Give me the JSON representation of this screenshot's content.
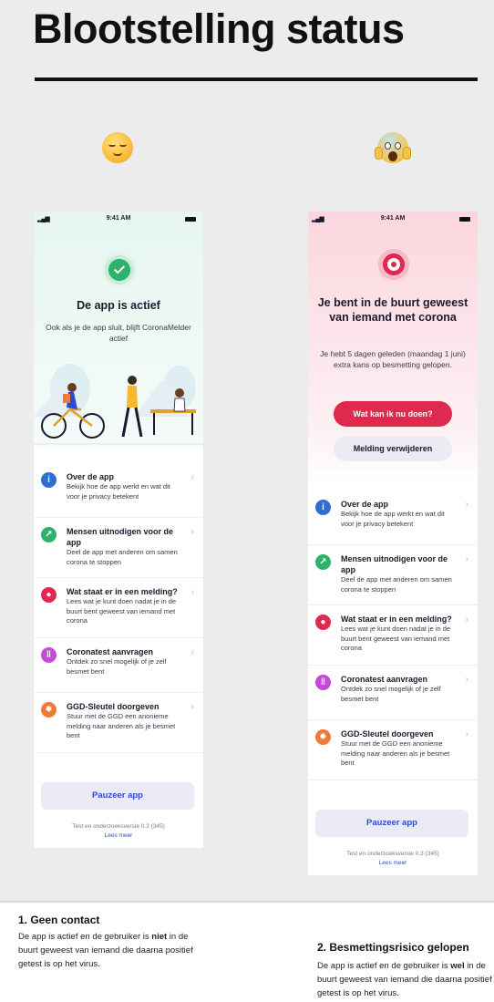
{
  "page": {
    "title": "Blootstelling status"
  },
  "left_phone": {
    "status": {
      "time": "9:41 AM"
    },
    "hero": {
      "title": "De app is actief",
      "text": "Ook als je de app sluit, blijft CoronaMelder actief"
    },
    "menu": [
      {
        "label": "Over de app",
        "desc": "Bekijk hoe de app werkt en wat dit voor je privacy betekent",
        "icon": "info-icon",
        "color": "#2c6fd1"
      },
      {
        "label": "Mensen uitnodigen voor de app",
        "desc": "Deel de app met anderen om samen corona te stoppen",
        "icon": "share-icon",
        "color": "#2eb26b"
      },
      {
        "label": "Wat staat er in een melding?",
        "desc": "Lees wat je kunt doen nadat je in de buurt bent geweest van iemand met corona",
        "icon": "notification-icon",
        "color": "#e0294e"
      },
      {
        "label": "Coronatest aanvragen",
        "desc": "Ontdek zo snel mogelijk of je zelf besmet bent",
        "icon": "test-tube-icon",
        "color": "#c44bd6"
      },
      {
        "label": "GGD-Sleutel doorgeven",
        "desc": "Stuur met de GGD een anonieme melding naar anderen als je besmet bent",
        "icon": "virus-icon",
        "color": "#f07a3a"
      }
    ],
    "pause_button": "Pauzeer app",
    "version": "Test en onderzoeksversie 0.3 (345)",
    "more_link": "Lees meer"
  },
  "right_phone": {
    "status": {
      "time": "9:41 AM"
    },
    "hero": {
      "title": "Je bent in de buurt geweest van iemand met corona",
      "text": "Je hebt 5 dagen geleden (maandag 1 juni) extra kans op besmetting gelopen."
    },
    "primary_button": "Wat kan ik nu doen?",
    "secondary_button": "Melding verwijderen",
    "menu": [
      {
        "label": "Over de app",
        "desc": "Bekijk hoe de app werkt en wat dit voor je privacy betekent",
        "icon": "info-icon",
        "color": "#2c6fd1"
      },
      {
        "label": "Mensen uitnodigen voor de app",
        "desc": "Deel de app met anderen om samen corona te stoppen",
        "icon": "share-icon",
        "color": "#2eb26b"
      },
      {
        "label": "Wat staat er in een melding?",
        "desc": "Lees wat je kunt doen nadat je in de buurt bent geweest van iemand met corona",
        "icon": "notification-icon",
        "color": "#e0294e"
      },
      {
        "label": "Coronatest aanvragen",
        "desc": "Ontdek zo snel mogelijk of je zelf besmet bent",
        "icon": "test-tube-icon",
        "color": "#c44bd6"
      },
      {
        "label": "GGD-Sleutel doorgeven",
        "desc": "Stuur met de GGD een anonieme melding naar anderen als je besmet bent",
        "icon": "virus-icon",
        "color": "#f07a3a"
      }
    ],
    "pause_button": "Pauzeer app",
    "version": "Test en onderzoeksversie 0.3 (345)",
    "more_link": "Lees meer"
  },
  "captions": [
    {
      "title": "1. Geen contact",
      "text_before": "De app is actief en de gebruiker is ",
      "emphasis": "niet",
      "text_after": " in de buurt geweest van iemand die daarna positief getest is op het virus."
    },
    {
      "title": "2. Besmettingsrisico gelopen",
      "text_before": "De app is actief en de gebruiker is ",
      "emphasis": "wel",
      "text_after": " in de buurt geweest van iemand die daarna positief getest is op het virus."
    }
  ]
}
